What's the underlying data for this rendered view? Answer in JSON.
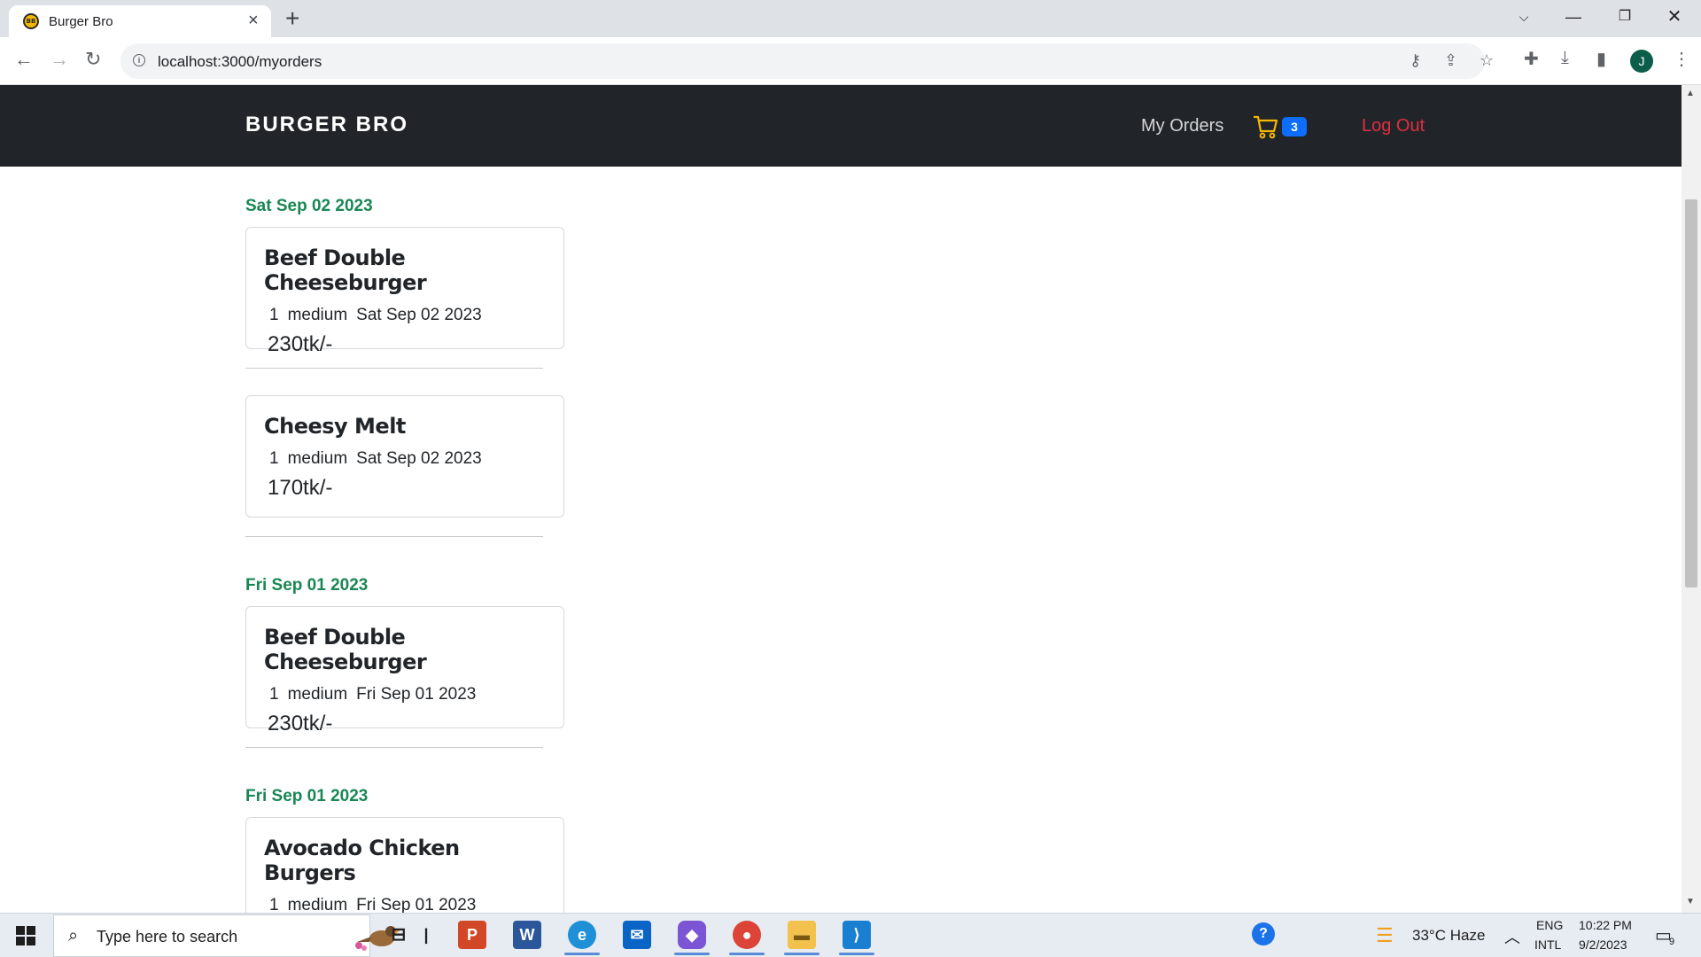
{
  "browser": {
    "tab_title": "Burger Bro",
    "url": "localhost:3000/myorders",
    "profile_initial": "J"
  },
  "navbar": {
    "brand": "BURGER BRO",
    "my_orders": "My Orders",
    "cart_count": "3",
    "logout": "Log Out"
  },
  "orders": [
    {
      "date": "Sat Sep 02 2023",
      "name": "Beef Double Cheeseburger",
      "qty": "1",
      "size": "medium",
      "item_date": "Sat Sep 02 2023",
      "price": "230tk/-"
    },
    {
      "date": "",
      "name": "Cheesy Melt",
      "qty": "1",
      "size": "medium",
      "item_date": "Sat Sep 02 2023",
      "price": "170tk/-"
    },
    {
      "date": "Fri Sep 01 2023",
      "name": "Beef Double Cheeseburger",
      "qty": "1",
      "size": "medium",
      "item_date": "Fri Sep 01 2023",
      "price": "230tk/-"
    },
    {
      "date": "Fri Sep 01 2023",
      "name": "Avocado Chicken Burgers",
      "qty": "1",
      "size": "medium",
      "item_date": "Fri Sep 01 2023",
      "price": ""
    }
  ],
  "taskbar": {
    "search_placeholder": "Type here to search",
    "weather": "33°C  Haze",
    "lang_top": "ENG",
    "lang_bottom": "INTL",
    "time": "10:22 PM",
    "date": "9/2/2023",
    "notifications": "9"
  },
  "colors": {
    "navbar_bg": "#212529",
    "date_green": "#198754",
    "logout_red": "#e02f3f",
    "badge_blue": "#0d6efd",
    "cart_yellow": "#f5b800"
  }
}
